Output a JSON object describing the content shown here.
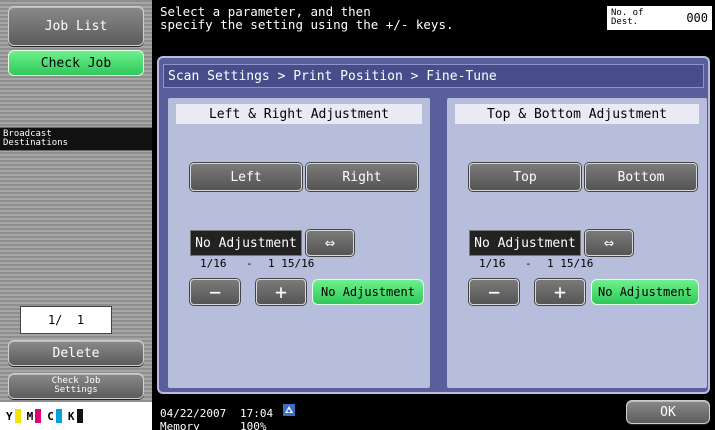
{
  "sidebar": {
    "job_list": "Job List",
    "check_job": "Check Job",
    "broadcast_destinations": "Broadcast\nDestinations",
    "page_indicator": "1/  1",
    "delete": "Delete",
    "check_job_settings": "Check Job\nSettings",
    "toner": [
      "Y",
      "M",
      "C",
      "K"
    ]
  },
  "header": {
    "instruction": "Select a parameter, and then\nspecify the setting using the +/- keys.",
    "dest_label": "No. of\nDest.",
    "dest_count": "000"
  },
  "breadcrumb": "Scan Settings > Print Position > Fine-Tune",
  "left_right": {
    "title": "Left & Right Adjustment",
    "btn_left": "Left",
    "btn_right": "Right",
    "value": "No Adjustment",
    "arrow": "⇔",
    "range_min": "1/16",
    "range_dash": "-",
    "range_max": "1 15/16",
    "minus": "−",
    "plus": "+",
    "no_adjust_btn": "No Adjustment"
  },
  "top_bottom": {
    "title": "Top & Bottom Adjustment",
    "btn_top": "Top",
    "btn_bottom": "Bottom",
    "value": "No Adjustment",
    "arrow": "⇔",
    "range_min": "1/16",
    "range_dash": "-",
    "range_max": "1 15/16",
    "minus": "−",
    "plus": "+",
    "no_adjust_btn": "No Adjustment"
  },
  "footer": {
    "date": "04/22/2007",
    "time": "17:04",
    "memory_label": "Memory",
    "memory_value": "100%",
    "ok": "OK"
  },
  "colors": {
    "panel": "#5a5f9c",
    "green_button": "#3fd86a",
    "toner_y": "#f2e400",
    "toner_m": "#e0007a",
    "toner_c": "#00a0e0",
    "toner_k": "#111111"
  },
  "icons": {
    "network": "network-icon"
  }
}
